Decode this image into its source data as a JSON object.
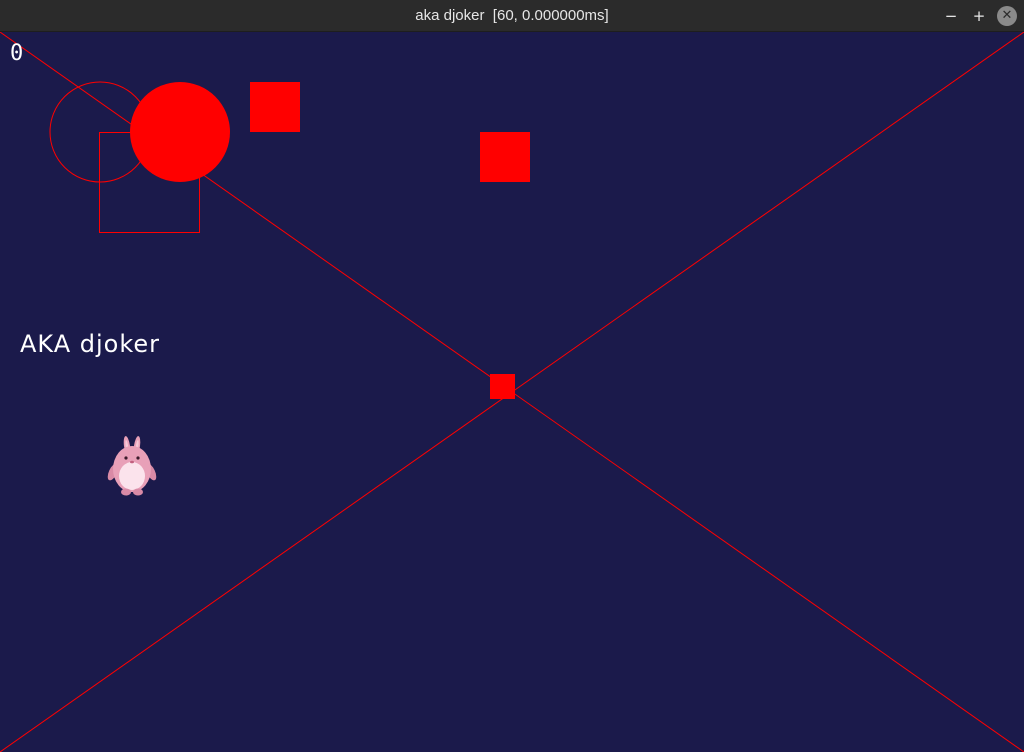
{
  "window": {
    "title": "aka djoker  [60, 0.000000ms]",
    "minimize_glyph": "−",
    "maximize_glyph": "+",
    "close_glyph": "✕"
  },
  "game": {
    "score": "0",
    "label": "AKA djoker",
    "background_color": "#1b1a4b",
    "accent_color": "#ff0000",
    "sprite": "pink-bunny-sprite"
  }
}
